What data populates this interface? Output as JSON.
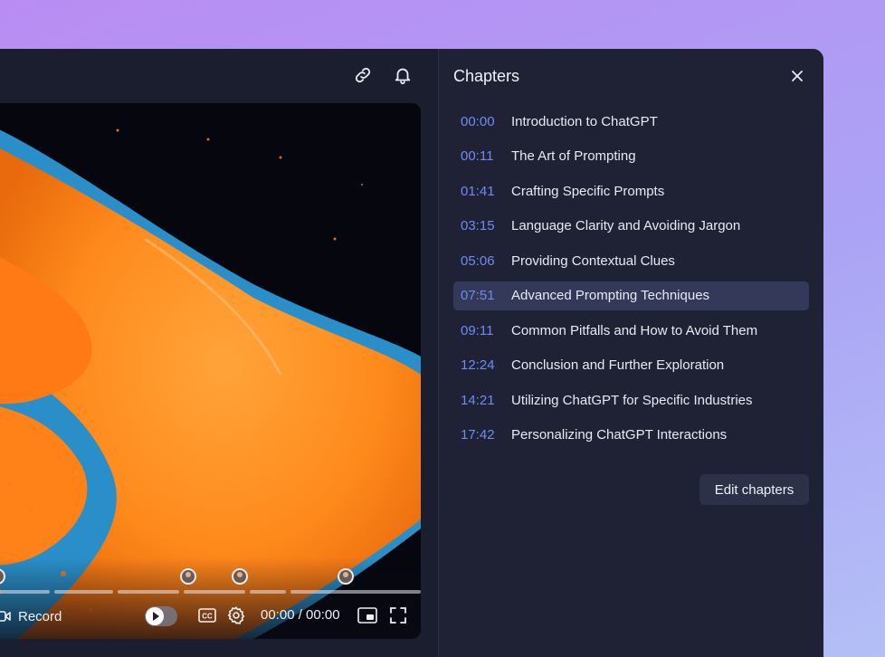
{
  "header": {
    "link_icon": "link-icon",
    "bell_icon": "bell-icon"
  },
  "player": {
    "record_label": "Record",
    "time_display": "00:00 / 00:00",
    "progress_fraction": 0
  },
  "chapters": {
    "title": "Chapters",
    "close_icon": "close-icon",
    "items": [
      {
        "time": "00:00",
        "label": "Introduction to ChatGPT",
        "active": false
      },
      {
        "time": "00:11",
        "label": "The Art of Prompting",
        "active": false
      },
      {
        "time": "01:41",
        "label": "Crafting Specific Prompts",
        "active": false
      },
      {
        "time": "03:15",
        "label": "Language Clarity and Avoiding Jargon",
        "active": false
      },
      {
        "time": "05:06",
        "label": "Providing Contextual Clues",
        "active": false
      },
      {
        "time": "07:51",
        "label": "Advanced Prompting Techniques",
        "active": true
      },
      {
        "time": "09:11",
        "label": "Common Pitfalls and How to Avoid Them",
        "active": false
      },
      {
        "time": "12:24",
        "label": "Conclusion and Further Exploration",
        "active": false
      },
      {
        "time": "14:21",
        "label": "Utilizing ChatGPT for Specific Industries",
        "active": false
      },
      {
        "time": "17:42",
        "label": "Personalizing ChatGPT Interactions",
        "active": false
      }
    ],
    "edit_label": "Edit chapters"
  },
  "colors": {
    "accent_time": "#6f8bf2",
    "active_row": "#34395a",
    "panel_bg": "#1f2235"
  }
}
